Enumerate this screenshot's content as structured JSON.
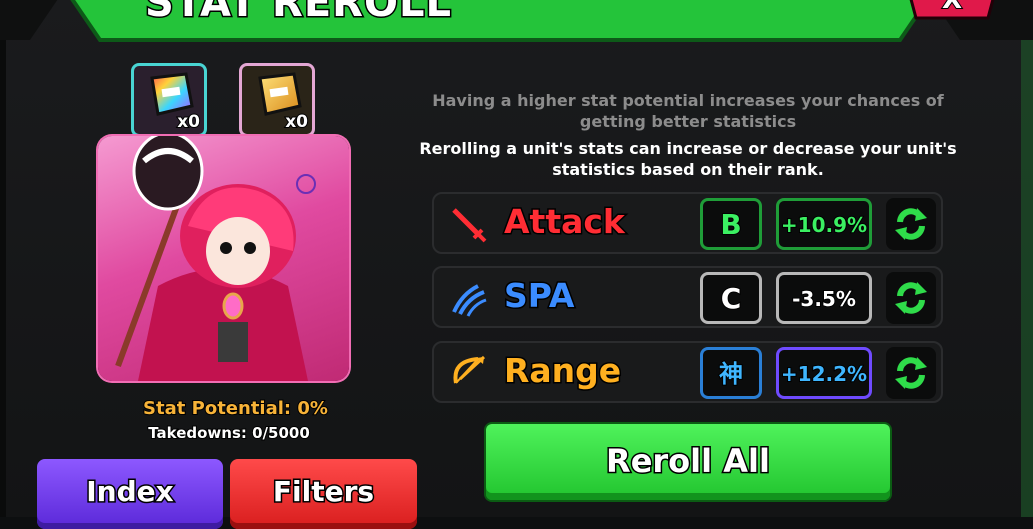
{
  "window": {
    "title": "STAT REROLL",
    "close_label": "X"
  },
  "tickets": [
    {
      "icon": "stat-reroll-ticket-icon",
      "count": "x0"
    },
    {
      "icon": "stat-reroll-ticket-icon",
      "count": "x0"
    }
  ],
  "unit": {
    "stat_potential": "Stat Potential: 0%",
    "takedowns": "Takedowns: 0/5000"
  },
  "buttons": {
    "index": "Index",
    "filters": "Filters",
    "reroll_all": "Reroll All"
  },
  "info": {
    "muted": "Having a higher stat potential increases your chances of getting better statistics",
    "strong": "Rerolling a unit's stats can increase or decrease your unit's statistics based on their rank."
  },
  "stats": [
    {
      "name": "Attack",
      "icon": "sword-icon",
      "grade": "B",
      "percent": "+10.9%",
      "name_color": "#ff2d34",
      "grade_color": "#3bf062",
      "border_color": "#1f9d38"
    },
    {
      "name": "SPA",
      "icon": "claw-icon",
      "grade": "C",
      "percent": "-3.5%",
      "name_color": "#3b8cff",
      "grade_color": "#ffffff",
      "border_color": "#b8b8b8"
    },
    {
      "name": "Range",
      "icon": "bow-icon",
      "grade": "神",
      "percent": "+12.2%",
      "name_color": "#ffb020",
      "grade_color": "#3fb6ff",
      "border_color": "#6f4bff"
    }
  ],
  "colors": {
    "accent_green": "#22c32f",
    "potential_text": "#f7b338"
  }
}
